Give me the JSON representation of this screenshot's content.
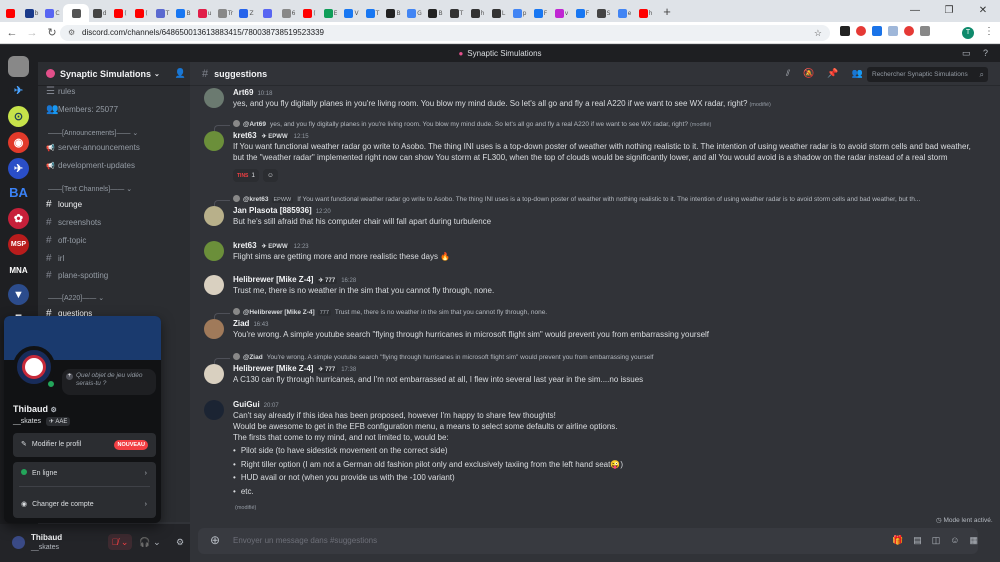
{
  "browser": {
    "tabs": [
      {
        "icon": "youtube-icon",
        "color": "#ff0000",
        "text": ""
      },
      {
        "icon": "uk-flag-icon",
        "color": "#1a3a8a",
        "text": "b"
      },
      {
        "icon": "discord-tab-icon",
        "color": "#5865f2",
        "text": "C"
      },
      {
        "icon": "active-tab-icon",
        "color": "#555555",
        "text": ""
      },
      {
        "icon": "gear-tab-icon",
        "color": "#444444",
        "text": "d"
      },
      {
        "icon": "youtube-icon",
        "color": "#ff0000",
        "text": "("
      },
      {
        "icon": "youtube-icon",
        "color": "#ff0000",
        "text": "("
      },
      {
        "icon": "o-tab-icon",
        "color": "#5b6ad0",
        "text": "T"
      },
      {
        "icon": "b-tab-icon",
        "color": "#1877f2",
        "text": "B"
      },
      {
        "icon": "r-tab-icon",
        "color": "#e11d48",
        "text": "u"
      },
      {
        "icon": "t-tab-icon",
        "color": "#888888",
        "text": "Tr"
      },
      {
        "icon": "z-tab-icon",
        "color": "#2563eb",
        "text": "Z"
      },
      {
        "icon": "discord-tab-icon",
        "color": "#5865f2",
        "text": ""
      },
      {
        "icon": "script-tab-icon",
        "color": "#888888",
        "text": "6"
      },
      {
        "icon": "youtube-icon",
        "color": "#ff0000",
        "text": "("
      },
      {
        "icon": "e-tab-icon",
        "color": "#0f9d58",
        "text": "E"
      },
      {
        "icon": "facebook-icon",
        "color": "#1877f2",
        "text": "V"
      },
      {
        "icon": "facebook-icon",
        "color": "#1877f2",
        "text": "T"
      },
      {
        "icon": "b-tab-icon",
        "color": "#222222",
        "text": "B"
      },
      {
        "icon": "google-icon",
        "color": "#4285f4",
        "text": "G"
      },
      {
        "icon": "b-tab-icon",
        "color": "#222222",
        "text": "B"
      },
      {
        "icon": "w-tab-icon",
        "color": "#333333",
        "text": "T"
      },
      {
        "icon": "github-icon",
        "color": "#333333",
        "text": "h"
      },
      {
        "icon": "github-icon",
        "color": "#333333",
        "text": "L"
      },
      {
        "icon": "google-icon",
        "color": "#4285f4",
        "text": "p"
      },
      {
        "icon": "facebook-icon",
        "color": "#1877f2",
        "text": "F"
      },
      {
        "icon": "v-tab-icon",
        "color": "#c026d3",
        "text": "v"
      },
      {
        "icon": "facebook-icon",
        "color": "#1877f2",
        "text": "F"
      },
      {
        "icon": "s-tab-icon",
        "color": "#444444",
        "text": "S"
      },
      {
        "icon": "google-icon",
        "color": "#4285f4",
        "text": "e"
      },
      {
        "icon": "youtube-icon",
        "color": "#ff0000",
        "text": "h"
      }
    ],
    "url": "discord.com/channels/648650013613883415/780038738519523339",
    "profile_initial": "T"
  },
  "discord": {
    "window_title": "Synaptic Simulations",
    "server_name": "Synaptic Simulations",
    "channel": "suggestions",
    "search_placeholder": "Rechercher Synaptic Simulations",
    "composer_placeholder": "Envoyer un message dans #suggestions",
    "slow_mode": "Mode lent activé."
  },
  "sidebar": {
    "items": [
      {
        "kind": "chan",
        "label": "rules",
        "icon": "rules-icon"
      },
      {
        "kind": "chan",
        "label": "Members: 25077",
        "icon": "members-icon"
      },
      {
        "kind": "cat",
        "label": "——[Announcements]——"
      },
      {
        "kind": "chan",
        "label": "server-announcements",
        "icon": "megaphone-icon"
      },
      {
        "kind": "chan",
        "label": "development-updates",
        "icon": "megaphone-icon"
      },
      {
        "kind": "cat",
        "label": "——[Text Channels]——"
      },
      {
        "kind": "chan",
        "label": "lounge",
        "icon": "hash-icon",
        "active": true
      },
      {
        "kind": "chan",
        "label": "screenshots",
        "icon": "hash-icon"
      },
      {
        "kind": "chan",
        "label": "off-topic",
        "icon": "hash-icon"
      },
      {
        "kind": "chan",
        "label": "irl",
        "icon": "hash-icon"
      },
      {
        "kind": "chan",
        "label": "plane-spotting",
        "icon": "hash-icon"
      },
      {
        "kind": "cat",
        "label": "——[A220]——"
      },
      {
        "kind": "chan",
        "label": "questions",
        "icon": "hash-icon",
        "active": true
      }
    ]
  },
  "user": {
    "display_name": "Thibaud",
    "username": "__skates",
    "badge": "AAE",
    "status_placeholder": "Quel objet de jeu vidéo serais-tu ?",
    "menu": {
      "edit_profile": "Modifier le profil",
      "new_badge": "NOUVEAU",
      "online": "En ligne",
      "switch_account": "Changer de compte"
    }
  },
  "messages": [
    {
      "author": "Art69",
      "time": "10:18",
      "text": "yes, and you fly digitally planes in you're living room. You blow my mind dude. So let's all go and fly a real A220 if we want to see WX radar, right?",
      "edited": "(modifié)"
    },
    {
      "reply_name": "@Art69",
      "reply_text": "yes, and you fly digitally planes in you're living room. You blow my mind dude. So let's all go and fly a real A220 if we want to see WX radar, right?",
      "reply_edited": "(modifié)",
      "author": "kret63",
      "tag": "EPWW",
      "time": "12:15",
      "lines": [
        "If You want functional weather radar go write to Asobo. The thing INI uses is a top-down poster of weather with nothing realistic to it. The intention of using weather radar is to avoid storm cells and bad weather,",
        "but the \"weather radar\" implemented right now can show You storm at FL300, when the top of clouds would be significantly lower, and all You would avoid is a shadow on the radar instead of a real storm"
      ],
      "reaction_label": "TINS",
      "reaction_count": "1"
    },
    {
      "reply_name": "@kret63",
      "reply_tag": "EPWW",
      "reply_text": "If You want functional weather radar go write to Asobo. The thing INI uses is a top-down poster of weather with nothing realistic to it. The intention of using weather radar is to avoid storm cells and bad weather, but th...",
      "author": "Jan Plasota [885936]",
      "time": "12:20",
      "text": "But he's still afraid that his computer chair will fall apart during turbulence"
    },
    {
      "author": "kret63",
      "tag": "EPWW",
      "time": "12:23",
      "text": "Flight sims are getting more and more realistic these days"
    },
    {
      "author": "Helibrewer [Mike Z-4]",
      "tag": "777",
      "time": "16:28",
      "text": "Trust me, there is no weather in the sim that you cannot fly through, none."
    },
    {
      "reply_name": "@Helibrewer [Mike Z-4]",
      "reply_tag": "777",
      "reply_text": "Trust me, there is no weather in the sim that you cannot fly through, none.",
      "author": "Ziad",
      "time": "16:43",
      "text": "You're wrong.  A simple youtube search \"flying through hurricanes in microsoft flight sim\" would prevent you from embarrassing yourself"
    },
    {
      "reply_name": "@Ziad",
      "reply_text": "You're wrong.  A simple youtube search \"flying through hurricanes in microsoft flight sim\" would prevent you from embarrassing yourself",
      "author": "Helibrewer [Mike Z-4]",
      "tag": "777",
      "time": "17:38",
      "text": "A C130 can fly through hurricanes, and I'm not embarrassed at all, I flew into several last year in the sim....no issues"
    },
    {
      "author": "GuiGui",
      "time": "20:07",
      "lines": [
        "Can't say already if this idea has been proposed, however I'm happy to share few thoughts!",
        "Would be awesome to get in the EFB configuration menu, a means to select some defaults or airline options.",
        "The firsts that come to my mind, and not limited to, would be:"
      ],
      "bullets": [
        "Pilot side (to have sidestick movement on the correct side)",
        "Right tiller option (I am not a German old fashion pilot only and exclusively taxiing from the left hand seat",
        "HUD avail or not (when you provide us with the -100 variant)",
        "etc."
      ],
      "bullet_suffix": ")",
      "edited": "(modifié)"
    }
  ]
}
